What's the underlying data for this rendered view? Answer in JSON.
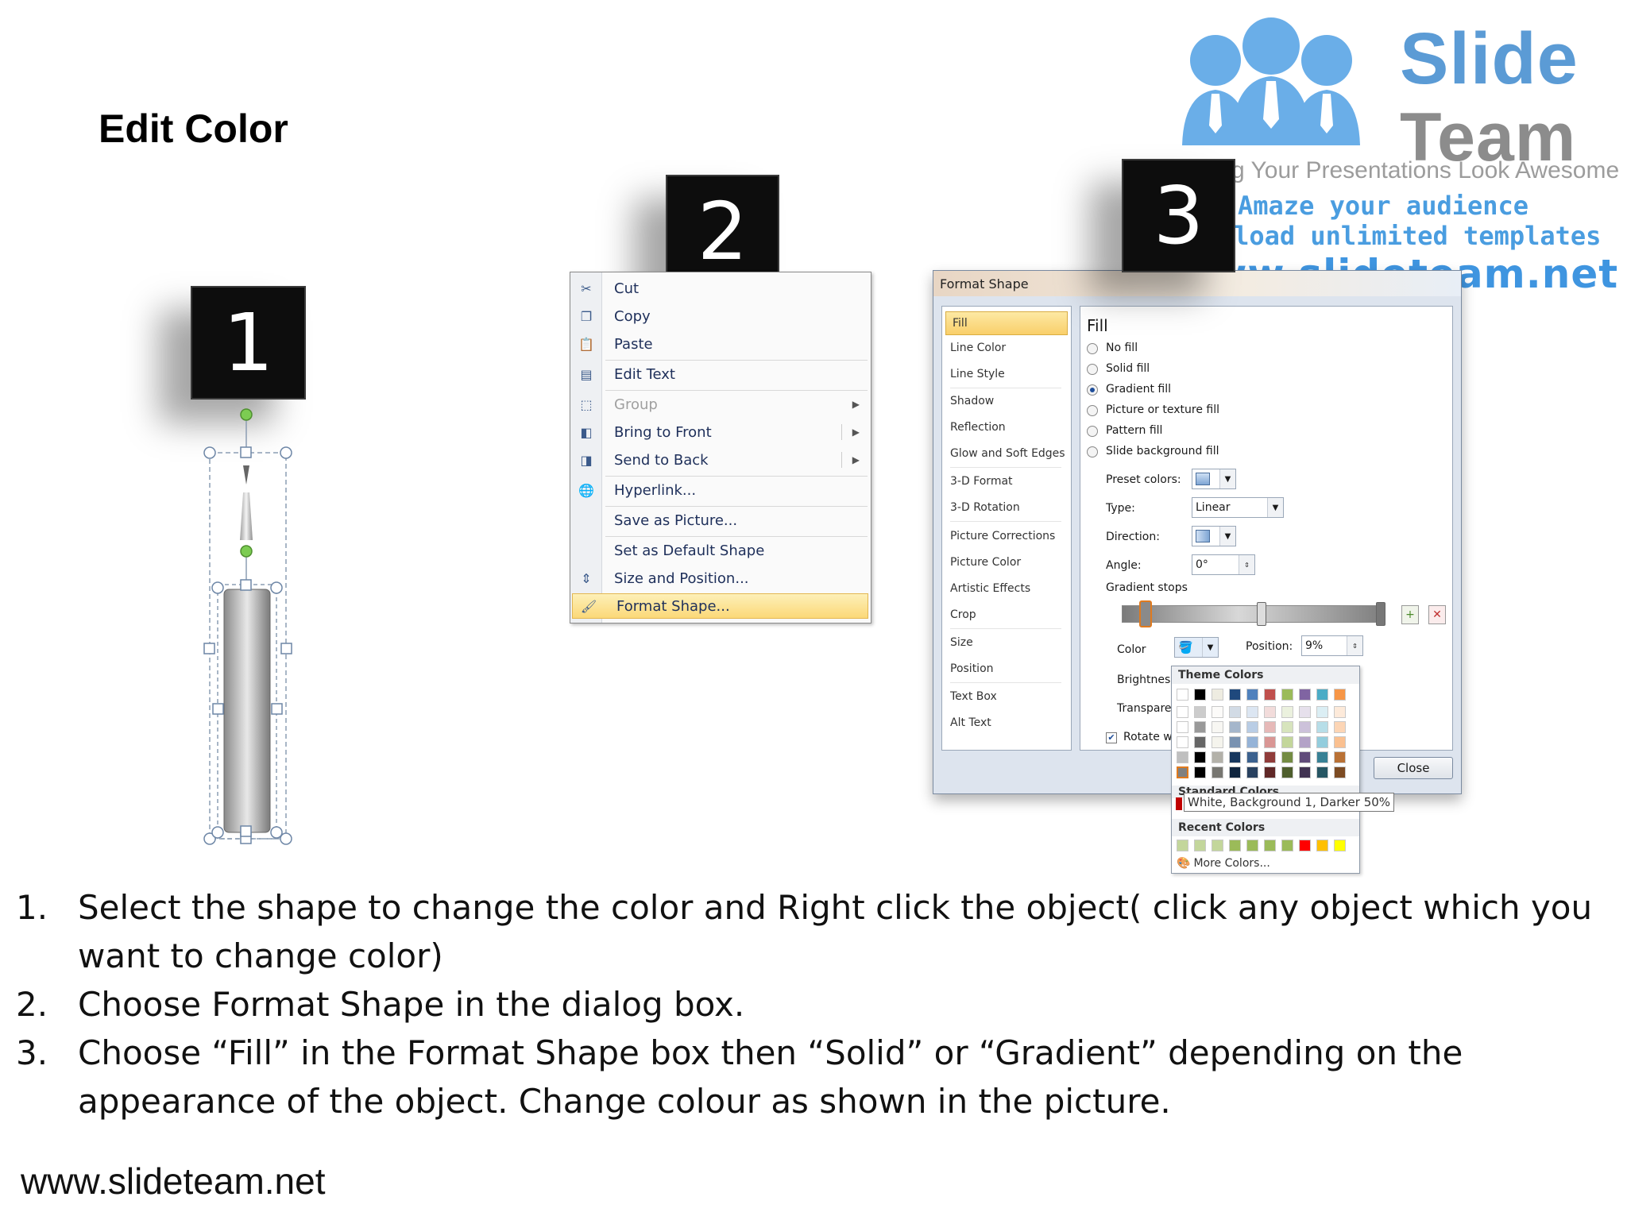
{
  "title": "Edit Color",
  "logo": {
    "name_line1": "Slide",
    "name_line2": "Team",
    "tagline": "Making Your Presentations Look Awesome",
    "promo_line1": "Amaze your audience",
    "promo_line2": "Download unlimited templates",
    "url": "www.slideteam.net"
  },
  "steps": [
    "1",
    "2",
    "3"
  ],
  "context_menu": {
    "items": [
      {
        "label": "Cut",
        "icon": "scissors-icon"
      },
      {
        "label": "Copy",
        "icon": "copy-icon"
      },
      {
        "label": "Paste",
        "icon": "paste-icon"
      },
      {
        "label": "Edit Text",
        "icon": "edit-text-icon"
      },
      {
        "label": "Group",
        "icon": "group-icon",
        "disabled": true,
        "submenu": true
      },
      {
        "label": "Bring to Front",
        "icon": "bring-to-front-icon",
        "submenu": true
      },
      {
        "label": "Send to Back",
        "icon": "send-to-back-icon",
        "submenu": true
      },
      {
        "label": "Hyperlink...",
        "icon": "hyperlink-icon"
      },
      {
        "label": "Save as Picture...",
        "icon": ""
      },
      {
        "label": "Set as Default Shape",
        "icon": ""
      },
      {
        "label": "Size and Position...",
        "icon": "size-position-icon"
      },
      {
        "label": "Format Shape...",
        "icon": "format-shape-icon",
        "highlighted": true
      }
    ]
  },
  "format_dialog": {
    "title": "Format Shape",
    "nav": [
      "Fill",
      "Line Color",
      "Line Style",
      "Shadow",
      "Reflection",
      "Glow and Soft Edges",
      "3-D Format",
      "3-D Rotation",
      "Picture Corrections",
      "Picture Color",
      "Artistic Effects",
      "Crop",
      "Size",
      "Position",
      "Text Box",
      "Alt Text"
    ],
    "active_nav": "Fill",
    "section_title": "Fill",
    "fill_options": [
      {
        "label": "No fill",
        "selected": false
      },
      {
        "label": "Solid fill",
        "selected": false
      },
      {
        "label": "Gradient fill",
        "selected": true
      },
      {
        "label": "Picture or texture fill",
        "selected": false
      },
      {
        "label": "Pattern fill",
        "selected": false
      },
      {
        "label": "Slide background fill",
        "selected": false
      }
    ],
    "preset_colors_label": "Preset colors:",
    "type_label": "Type:",
    "type_value": "Linear",
    "direction_label": "Direction:",
    "angle_label": "Angle:",
    "angle_value": "0°",
    "gradient_stops_label": "Gradient stops",
    "color_label": "Color",
    "position_label": "Position:",
    "position_value": "9%",
    "brightness_label": "Brightness",
    "transparency_label": "Transparen",
    "rotate_label": "Rotate w",
    "close_label": "Close"
  },
  "palette": {
    "theme_colors_label": "Theme Colors",
    "standard_colors_label": "Standard Colors",
    "recent_colors_label": "Recent Colors",
    "more_colors_label": "More Colors...",
    "tooltip": "White, Background 1, Darker 50%",
    "theme_top": [
      "#ffffff",
      "#000000",
      "#eeece1",
      "#1f497d",
      "#4f81bd",
      "#c0504d",
      "#9bbb59",
      "#8064a2",
      "#4bacc6",
      "#f79646"
    ],
    "recent": [
      "#c3d69b",
      "#c3d69b",
      "#c3d69b",
      "#9bbb59",
      "#9bbb59",
      "#9bbb59",
      "#9bbb59",
      "#ff0000",
      "#ffc000",
      "#ffff00"
    ]
  },
  "instructions": [
    {
      "num": "1.",
      "text": "Select the shape to change the color and Right click the object( click any object which you want to change color)"
    },
    {
      "num": "2.",
      "text": "Choose Format Shape in the dialog box."
    },
    {
      "num": "3.",
      "text": "Choose “Fill” in the Format Shape box then “Solid” or “Gradient” depending on the appearance of the object. Change colour as shown in the picture."
    }
  ],
  "footer_url": "www.slideteam.net"
}
